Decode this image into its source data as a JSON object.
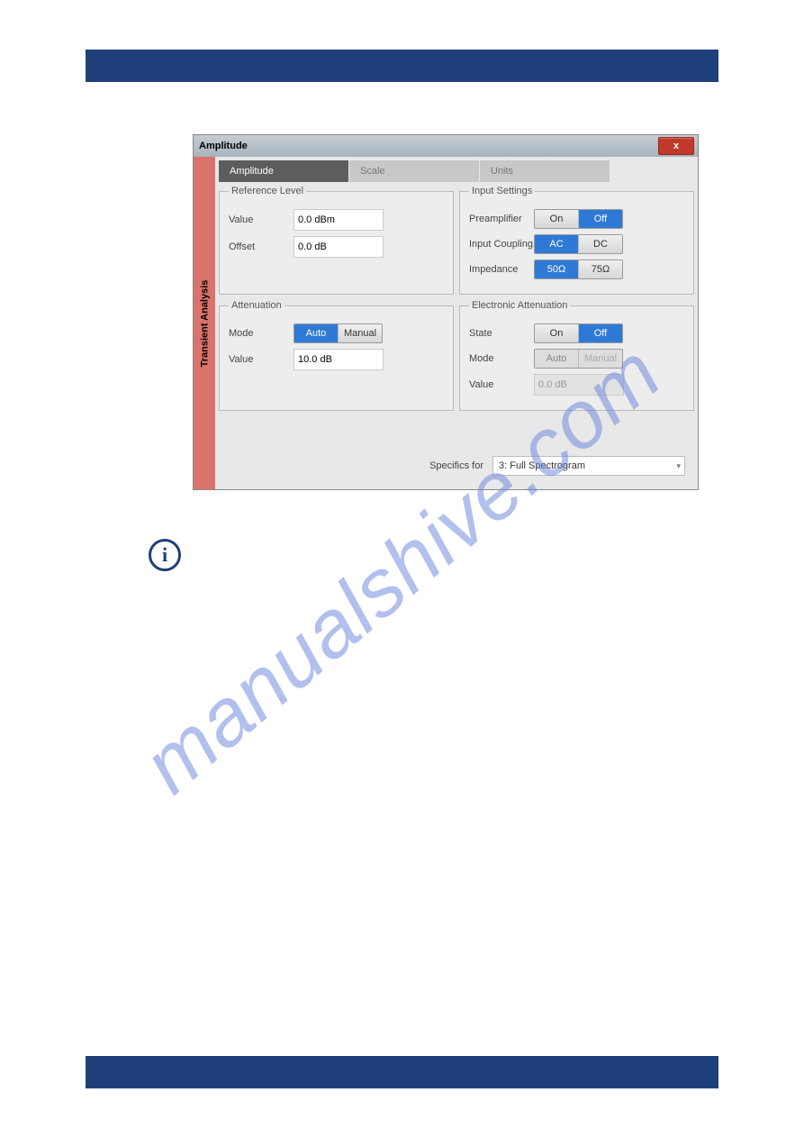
{
  "watermark": "manualshive.com",
  "window": {
    "title": "Amplitude",
    "close_glyph": "x",
    "sidestrip": "Transient Analysis",
    "tabs": [
      "Amplitude",
      "Scale",
      "Units"
    ],
    "reference_level": {
      "legend": "Reference Level",
      "value_label": "Value",
      "value_field": "0.0 dBm",
      "offset_label": "Offset",
      "offset_field": "0.0 dB"
    },
    "attenuation": {
      "legend": "Attenuation",
      "mode_label": "Mode",
      "mode_options": [
        "Auto",
        "Manual"
      ],
      "value_label": "Value",
      "value_field": "10.0 dB"
    },
    "input_settings": {
      "legend": "Input Settings",
      "preamp_label": "Preamplifier",
      "preamp_options": [
        "On",
        "Off"
      ],
      "coupling_label": "Input Coupling",
      "coupling_options": [
        "AC",
        "DC"
      ],
      "impedance_label": "Impedance",
      "impedance_options": [
        "50Ω",
        "75Ω"
      ]
    },
    "electronic_attenuation": {
      "legend": "Electronic Attenuation",
      "state_label": "State",
      "state_options": [
        "On",
        "Off"
      ],
      "mode_label": "Mode",
      "mode_options": [
        "Auto",
        "Manual"
      ],
      "value_label": "Value",
      "value_field": "0.0 dB"
    },
    "footer": {
      "label": "Specifics for",
      "select_value": "3: Full Spectrogram"
    }
  },
  "info_glyph": "i"
}
